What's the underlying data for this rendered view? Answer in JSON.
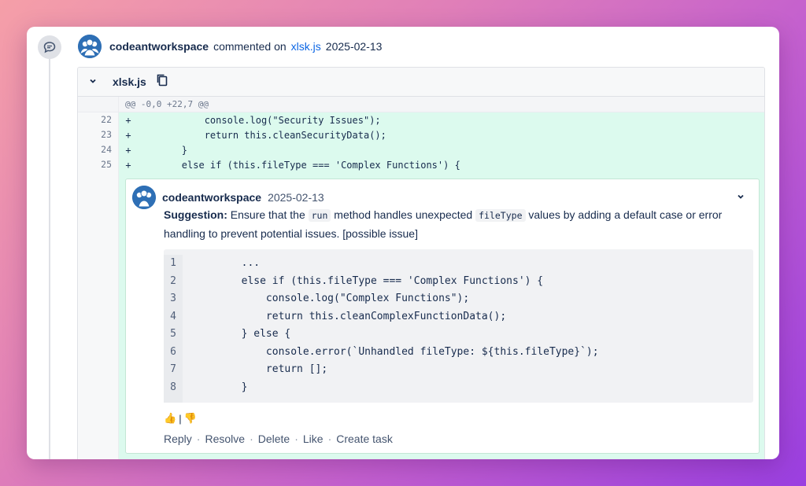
{
  "activity": {
    "user": "codeantworkspace",
    "action_text": "commented on",
    "file_link": "xlsk.js",
    "date": "2025-02-13"
  },
  "file": {
    "name": "xlsk.js",
    "hunk_header": "@@ -0,0 +22,7 @@",
    "lines": [
      {
        "num": "22",
        "sign": "+",
        "code": "            console.log(\"Security Issues\");"
      },
      {
        "num": "23",
        "sign": "+",
        "code": "            return this.cleanSecurityData();"
      },
      {
        "num": "24",
        "sign": "+",
        "code": "        }"
      },
      {
        "num": "25",
        "sign": "+",
        "code": "        else if (this.fileType === 'Complex Functions') {"
      }
    ]
  },
  "comment": {
    "user": "codeantworkspace",
    "date": "2025-02-13",
    "suggestion_label": "Suggestion:",
    "text_1": " Ensure that the ",
    "code_1": "run",
    "text_2": " method handles unexpected ",
    "code_2": "fileType",
    "text_3": " values by adding a default case or error handling to prevent potential issues. [possible issue]",
    "code_lines": [
      {
        "num": "1",
        "code": "        ..."
      },
      {
        "num": "2",
        "code": "        else if (this.fileType === 'Complex Functions') {"
      },
      {
        "num": "3",
        "code": "            console.log(\"Complex Functions\");"
      },
      {
        "num": "4",
        "code": "            return this.cleanComplexFunctionData();"
      },
      {
        "num": "5",
        "code": "        } else {"
      },
      {
        "num": "6",
        "code": "            console.error(`Unhandled fileType: ${this.fileType}`);"
      },
      {
        "num": "7",
        "code": "            return [];"
      },
      {
        "num": "8",
        "code": "        }"
      }
    ],
    "reaction_like": "👍",
    "reaction_sep": "|",
    "reaction_dislike": "👎",
    "actions": [
      "Reply",
      "Resolve",
      "Delete",
      "Like",
      "Create task"
    ],
    "action_sep": "·"
  }
}
